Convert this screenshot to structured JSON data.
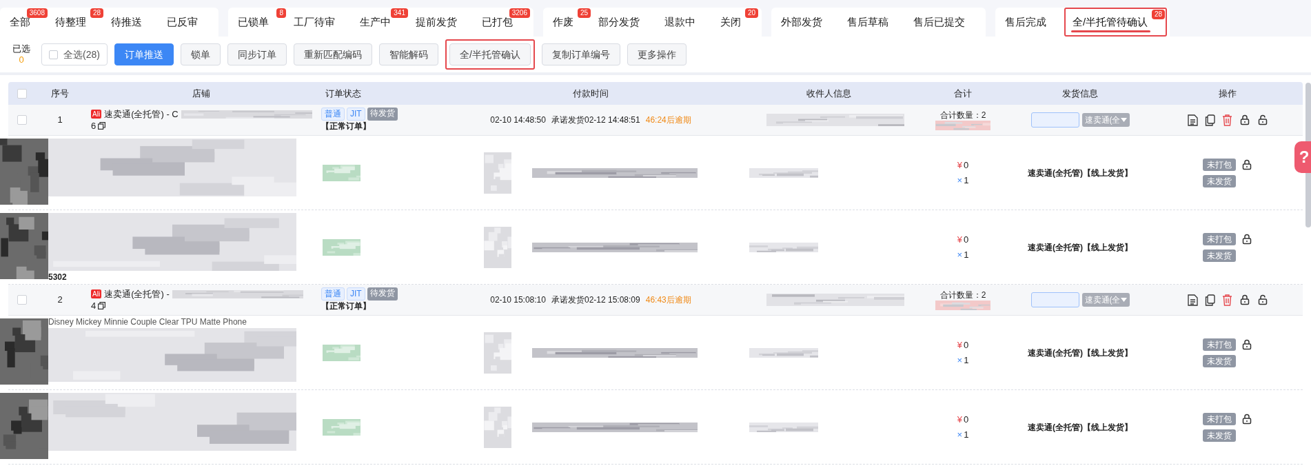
{
  "tab_groups": [
    {
      "tabs": [
        {
          "label": "全部",
          "badge": "3608",
          "selected": false
        },
        {
          "label": "待整理",
          "badge": "28",
          "selected": false
        },
        {
          "label": "待推送",
          "selected": false
        },
        {
          "label": "已反审",
          "selected": false
        }
      ]
    },
    {
      "tabs": [
        {
          "label": "已锁单",
          "badge": "8",
          "selected": false
        },
        {
          "label": "工厂待审",
          "selected": false
        },
        {
          "label": "生产中",
          "badge": "341",
          "selected": false
        },
        {
          "label": "提前发货",
          "selected": false
        },
        {
          "label": "已打包",
          "badge": "3206",
          "selected": false
        }
      ]
    },
    {
      "tabs": [
        {
          "label": "作废",
          "badge": "25",
          "selected": false
        },
        {
          "label": "部分发货",
          "selected": false
        },
        {
          "label": "退款中",
          "selected": false
        },
        {
          "label": "关闭",
          "badge": "20",
          "selected": false
        }
      ]
    },
    {
      "tabs": [
        {
          "label": "外部发货",
          "selected": false
        },
        {
          "label": "售后草稿",
          "selected": false
        },
        {
          "label": "售后已提交",
          "selected": false
        }
      ]
    },
    {
      "tabs": [
        {
          "label": "售后完成",
          "selected": false
        },
        {
          "label": "全/半托管待确认",
          "badge": "28",
          "selected": true
        }
      ]
    }
  ],
  "toolbar": {
    "selected_label": "已选",
    "selected_count": "0",
    "select_all": {
      "label": "全选(28)",
      "checked": false
    },
    "buttons": [
      {
        "label": "订单推送",
        "kind": "primary",
        "highlighted": false
      },
      {
        "label": "锁单",
        "kind": "default",
        "highlighted": false
      },
      {
        "label": "同步订单",
        "kind": "default",
        "highlighted": false
      },
      {
        "label": "重新匹配编码",
        "kind": "default",
        "highlighted": false
      },
      {
        "label": "智能解码",
        "kind": "default",
        "highlighted": false
      },
      {
        "label": "全/半托管确认",
        "kind": "default",
        "highlighted": true
      },
      {
        "label": "复制订单编号",
        "kind": "default",
        "highlighted": false
      },
      {
        "label": "更多操作",
        "kind": "default",
        "highlighted": false
      }
    ]
  },
  "table": {
    "header_checkbox": {
      "checked": false
    },
    "columns": [
      "序号",
      "店铺",
      "订单状态",
      "付款时间",
      "收件人信息",
      "合计",
      "发货信息",
      "操作"
    ],
    "orders": [
      {
        "checked": false,
        "index": "1",
        "platform_badge": "Ali",
        "store": "速卖通(全托管) - C",
        "count": "6",
        "tags": [
          "普通",
          "JIT",
          "待发货"
        ],
        "order_type": "【正常订单】",
        "pay_time": "02-10 14:48:50",
        "promise": "承诺发货02-12 14:48:51",
        "overdue": "46:24后逾期",
        "total_qty": "合计数量：2",
        "ship_select": "速卖通(全",
        "items": [
          {
            "currency": "¥",
            "price": "0",
            "times": "×",
            "qty": "1",
            "ship": "速卖通(全托管)【线上发货】",
            "pack_tag": "未打包",
            "ship_tag": "未发货"
          },
          {
            "sku_text": "5302",
            "currency": "¥",
            "price": "0",
            "times": "×",
            "qty": "1",
            "ship": "速卖通(全托管)【线上发货】",
            "pack_tag": "未打包",
            "ship_tag": "未发货"
          }
        ]
      },
      {
        "checked": false,
        "index": "2",
        "platform_badge": "Ali",
        "store": "速卖通(全托管) -",
        "count": "4",
        "tags": [
          "普通",
          "JIT",
          "待发货"
        ],
        "order_type": "【正常订单】",
        "pay_time": "02-10 15:08:10",
        "promise": "承诺发货02-12 15:08:09",
        "overdue": "46:43后逾期",
        "total_qty": "合计数量：2",
        "ship_select": "速卖通(全",
        "items": [
          {
            "title_text": "Disney Mickey Minnie Couple Clear TPU Matte Phone",
            "currency": "¥",
            "price": "0",
            "times": "×",
            "qty": "1",
            "ship": "速卖通(全托管)【线上发货】",
            "pack_tag": "未打包",
            "ship_tag": "未发货"
          },
          {
            "currency": "¥",
            "price": "0",
            "times": "×",
            "qty": "1",
            "ship": "速卖通(全托管)【线上发货】",
            "pack_tag": "未打包",
            "ship_tag": "未发货"
          }
        ]
      }
    ]
  },
  "help_button": {
    "label": "?"
  }
}
